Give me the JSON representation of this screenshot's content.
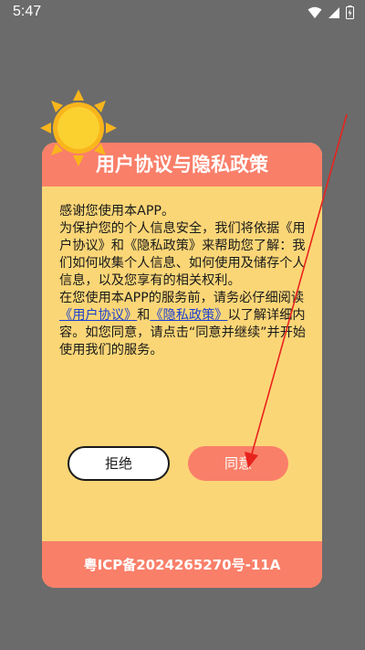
{
  "status_bar": {
    "time": "5:47",
    "icons": [
      "wifi-icon",
      "signal-icon",
      "battery-icon"
    ]
  },
  "dialog": {
    "title": "用户协议与隐私政策",
    "body": {
      "line_greeting": "感谢您使用本APP。",
      "para1": "为保护您的个人信息安全，我们将依据《用户协议》和《隐私政策》来帮助您了解：我们如何收集个人信息、如何使用及储存个人信息，以及您享有的相关权利。",
      "para2_prefix": "在您使用本APP的服务前，请务必仔细阅读",
      "link_user_agreement": "《用户协议》",
      "para2_and": "和",
      "link_privacy_policy": "《隐私政策》",
      "para2_suffix": "以了解详细内容。如您同意，请点击“同意并继续”并开始使用我们的服务。"
    },
    "reject_label": "拒绝",
    "agree_label": "同意",
    "footer": "粤ICP备2024265270号-11A"
  },
  "colors": {
    "background": "#6b6b6b",
    "dialog_bg": "#fbd677",
    "accent": "#f97f69",
    "link": "#1a3fd1",
    "annotation_arrow": "#e8231d"
  }
}
